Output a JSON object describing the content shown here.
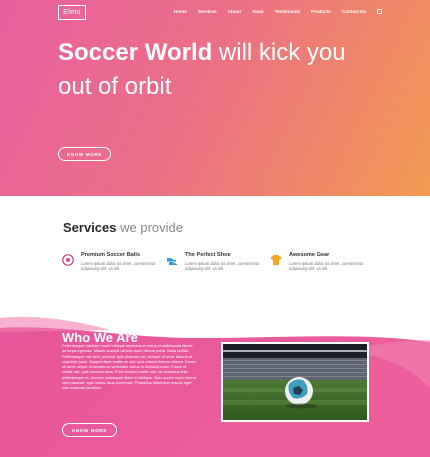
{
  "header": {
    "logo": "Eleto",
    "nav": [
      "Home",
      "Services",
      "About",
      "Team",
      "Testimonial",
      "Products",
      "Contact Us"
    ]
  },
  "hero": {
    "title_bold": "Soccer World",
    "title_rest": " will kick you out of orbit",
    "button": "KNOW MORE"
  },
  "services": {
    "title_bold": "Services",
    "title_rest": " we provide",
    "items": [
      {
        "icon": "soccer-ball-icon",
        "title": "Premium Soccer Balls",
        "text": "Lorem ipsum dolor sit amet, consectetur adipiscing elit. Ut elit."
      },
      {
        "icon": "shoe-icon",
        "title": "The Perfect Shoe",
        "text": "Lorem ipsum dolor sit amet, consectetur adipiscing elit. Ut elit."
      },
      {
        "icon": "jersey-icon",
        "title": "Awesome Gear",
        "text": "Lorem ipsum dolor sit amet, consectetur adipiscing elit. Ut elit."
      }
    ]
  },
  "who": {
    "title": "Who We Are",
    "text": "Pellentesque habitant morbi tristique senectus et netus et malesuada fames ac turpis egestas. Mauris suscipit ultrices dolor dictum porta. Nulla facilisi. Pellentesque nisi sem, pulvinar quis pharetra vel, semper ut urna. Mauris at vulputate justo. Suspendisse mattis ex nisl, quis mauris finibus ultrices. Donec sit amet neque venenatis ex venenatis varius in tincidunt tortor. Fusce et mattis nisl, quis rhoncus risus. Proin tempor mattis nisl, vel maximus felis pellentesque et. Aenean consequat libero id tristique. Duis auctor nunc viverra odio placerat, eget luctus risus commodo. Phasellus bibendum mauris eget odio euismod faucibus.",
    "button": "KNOW MORE"
  },
  "colors": {
    "gradient_start": "#e8609f",
    "gradient_end": "#f29a52",
    "who_pink": "#e8559a"
  }
}
